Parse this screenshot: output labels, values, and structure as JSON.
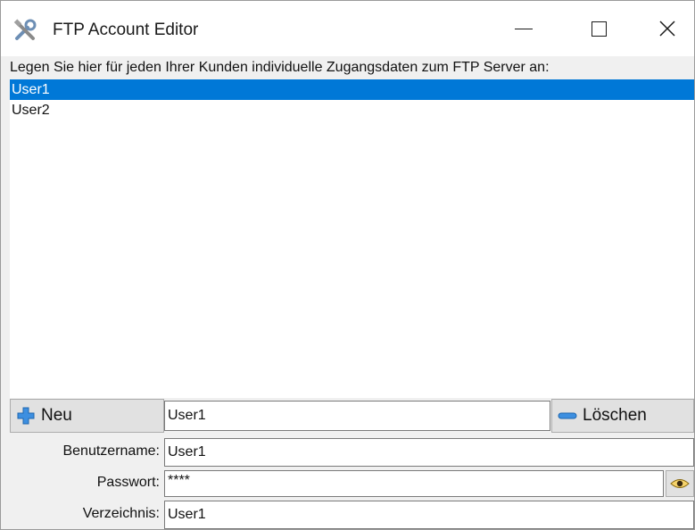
{
  "window": {
    "title": "FTP Account Editor",
    "icon": "tools-icon",
    "controls": [
      "minimize",
      "maximize",
      "close"
    ]
  },
  "instruction": "Legen Sie hier für jeden Ihrer Kunden individuelle Zugangsdaten zum FTP Server an:",
  "accounts": {
    "items": [
      "User1",
      "User2"
    ],
    "selected": "User1"
  },
  "buttons": {
    "new_label": "Neu",
    "delete_label": "Löschen"
  },
  "current_name": "User1",
  "form": {
    "username_label": "Benutzername:",
    "username_value": "User1",
    "password_label": "Passwort:",
    "password_value": "****",
    "directory_label": "Verzeichnis:",
    "directory_value": "User1"
  },
  "colors": {
    "selection": "#0078d7",
    "window_bg": "#f0f0f0"
  }
}
